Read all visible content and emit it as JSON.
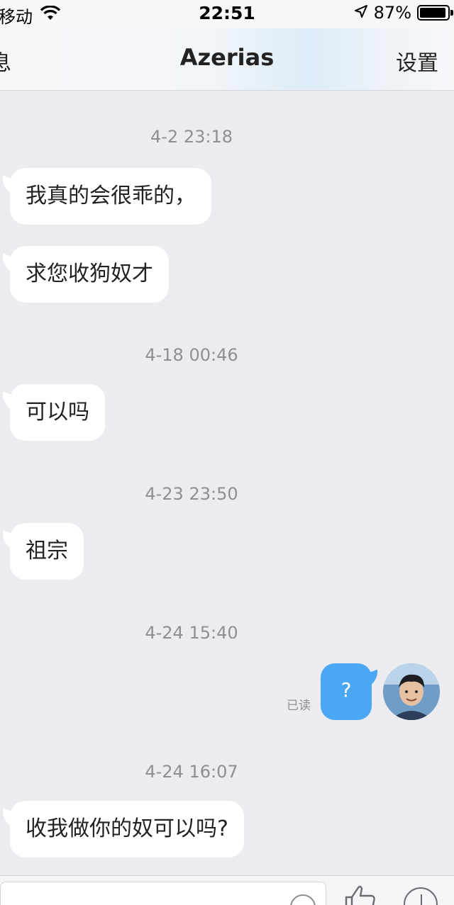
{
  "status_bar": {
    "carrier": "移动",
    "time": "22:51",
    "battery_percent": "87%",
    "battery_level": 0.87,
    "icons": [
      "wifi-icon",
      "location-arrow-icon",
      "battery-icon"
    ]
  },
  "nav": {
    "back_label": "息",
    "title": "Azerias",
    "settings_label": "设置"
  },
  "messages": [
    {
      "type": "timestamp",
      "text": "4-2 23:18"
    },
    {
      "type": "incoming",
      "text": "我真的会很乖的，"
    },
    {
      "type": "incoming",
      "text": "求您收狗奴才"
    },
    {
      "type": "timestamp",
      "text": "4-18 00:46"
    },
    {
      "type": "incoming",
      "text": "可以吗"
    },
    {
      "type": "timestamp",
      "text": "4-23 23:50"
    },
    {
      "type": "incoming",
      "text": "祖宗"
    },
    {
      "type": "timestamp",
      "text": "4-24 15:40"
    },
    {
      "type": "outgoing",
      "text": "?",
      "status": "已读"
    },
    {
      "type": "timestamp",
      "text": "4-24 16:07"
    },
    {
      "type": "incoming",
      "text": "收我做你的奴可以吗?"
    }
  ],
  "input_bar": {
    "icons": [
      "emoji-icon",
      "thumbs-up-icon",
      "plus-icon"
    ]
  },
  "colors": {
    "background": "#ececf0",
    "incoming_bubble": "#ffffff",
    "outgoing_bubble": "#4aa7f3",
    "timestamp_text": "#8e8e93"
  }
}
